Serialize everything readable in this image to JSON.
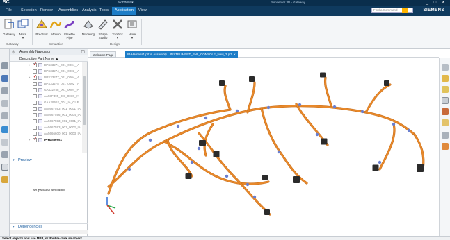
{
  "titlebar": {
    "app_logo": "SC",
    "quick_access": "Window ▾",
    "window_title": "Simcenter 3D - Gateway",
    "controls": "_ □ ✕"
  },
  "menubar": {
    "items": [
      "File",
      "Selection",
      "Render",
      "Assemblies",
      "Analysis",
      "Tools",
      "Application",
      "View"
    ],
    "active": "Application",
    "find_placeholder": "Find a Command",
    "brand": "SIEMENS"
  },
  "ribbon": {
    "buttons": [
      {
        "label": "Gateway",
        "icon": "gateway-icon"
      },
      {
        "label": "More\n▾",
        "icon": "more-icon"
      },
      {
        "label": "Pre/Post",
        "icon": "prepost-icon"
      },
      {
        "label": "Motion",
        "icon": "motion-icon"
      },
      {
        "label": "Flexible\nPipe",
        "icon": "flexible-pipe-icon"
      },
      {
        "label": "Modeling",
        "icon": "modeling-icon"
      },
      {
        "label": "Shape\nStudio",
        "icon": "shape-studio-icon"
      },
      {
        "label": "Toolbox\n▾",
        "icon": "toolbox-icon"
      },
      {
        "label": "More\n▾",
        "icon": "more-icon"
      }
    ],
    "groups": [
      "Gateway",
      "Simulation",
      "Design"
    ]
  },
  "navigator": {
    "title": "Assembly Navigator",
    "column": "Descriptive Part Name  ▲",
    "rows": [
      {
        "name": "DPS33271_001_0004_IA",
        "expand": "+",
        "checked": true
      },
      {
        "name": "DPS33274_001_0003_IA",
        "expand": "",
        "checked": false
      },
      {
        "name": "DPS33277_001_0004_IA",
        "expand": "+",
        "checked": true
      },
      {
        "name": "DPS33278_001_0002_IA",
        "expand": "",
        "checked": false
      },
      {
        "name": "GA432758_001_0004_IA",
        "expand": "",
        "checked": false
      },
      {
        "name": "AA58F495_001_0010_IA",
        "expand": "",
        "checked": false
      },
      {
        "name": "GAA29662_001_IA_CUP",
        "expand": "",
        "checked": false
      },
      {
        "name": "AA5667593_001_0001_IA",
        "expand": "",
        "checked": false
      },
      {
        "name": "AA5667596_001_0004_IA",
        "expand": "",
        "checked": false
      },
      {
        "name": "AA5667593_001_0001_IA",
        "expand": "",
        "checked": false
      },
      {
        "name": "AA5667593_001_0002_IA",
        "expand": "",
        "checked": false
      },
      {
        "name": "AA5666600_001_0003_IA",
        "expand": "",
        "checked": false
      },
      {
        "name": "IP-Harness1",
        "expand": "+",
        "checked": true,
        "root": true
      }
    ],
    "preview_title": "Preview",
    "preview_message": "No preview available",
    "dependencies_title": "Dependencies"
  },
  "tabs": {
    "welcome": "Welcome Page",
    "active": "IP-Harness1.prt in Assembly ...INSTRUMENT_PNL_CONSOLE_view_3.prt",
    "close": "×"
  },
  "status": {
    "text": "Select objects and use MB3, or double-click an object"
  },
  "colors": {
    "harness": "#e8892b",
    "harness_dark": "#c56b17",
    "accent": "#1d7dc7",
    "clip": "#6a7fd0",
    "connector": "#2b2b2b"
  }
}
